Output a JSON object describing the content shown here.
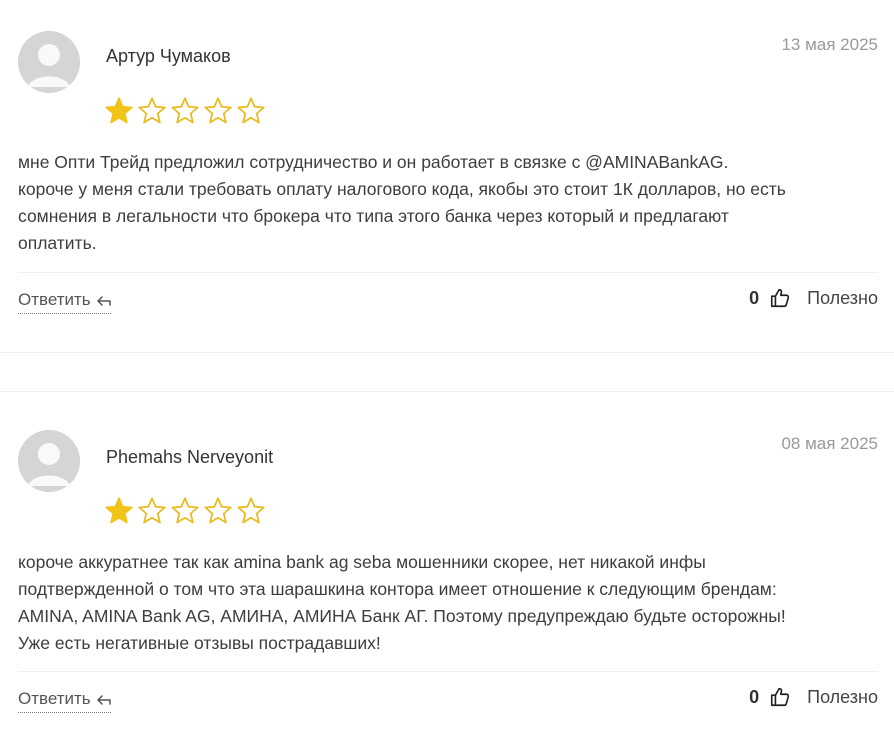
{
  "colors": {
    "star_filled": "#F2C418",
    "star_outline": "#E8BB1E",
    "date": "#999999",
    "divider": "#EEEEEE"
  },
  "reviews": [
    {
      "author": "Артур Чумаков",
      "date": "13 мая 2025",
      "rating": 1,
      "rating_max": 5,
      "lines": [
        "мне Опти Трейд предложил сотрудничество и он работает в связке с @AMINABankAG.",
        "короче у меня стали требовать оплату налогового кода, якобы это стоит 1К долларов, но есть",
        "сомнения в легальности что брокера что типа этого банка через который и предлагают",
        "оплатить."
      ],
      "reply_label": "Ответить",
      "helpful_count": "0",
      "helpful_label": "Полезно"
    },
    {
      "author": "Phemahs Nerveyonit",
      "date": "08 мая 2025",
      "rating": 1,
      "rating_max": 5,
      "lines": [
        "короче аккуратнее так как amina bank ag seba мошенники скорее, нет никакой инфы",
        "подтвержденной о том что эта шарашкина контора имеет отношение к следующим брендам:",
        "AMINA, AMINA Bank AG, АМИНА, АМИНА Банк АГ. Поэтому предупреждаю будьте осторожны!",
        "Уже есть негативные отзывы пострадавших!"
      ],
      "reply_label": "Ответить",
      "helpful_count": "0",
      "helpful_label": "Полезно"
    }
  ],
  "icons": {
    "avatar": "avatar-placeholder-icon",
    "star_filled": "star-filled-icon",
    "star_empty": "star-outline-icon",
    "reply": "reply-arrow-icon",
    "like": "thumbs-up-icon"
  }
}
